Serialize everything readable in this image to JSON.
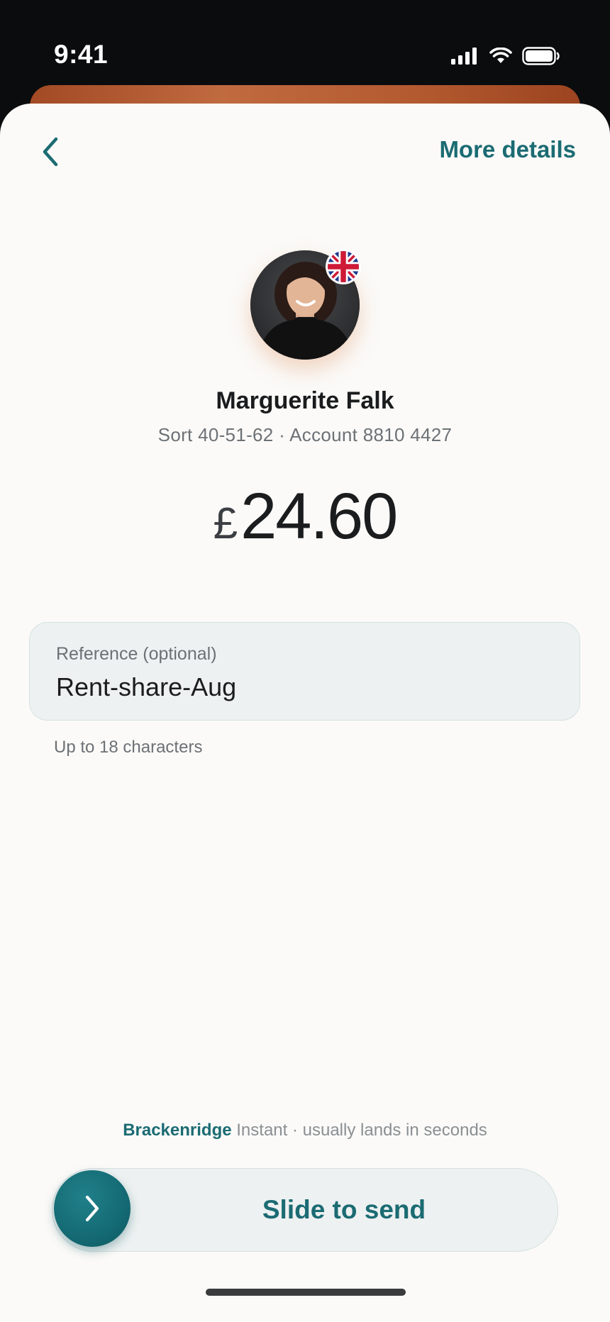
{
  "status_bar": {
    "time": "9:41",
    "icons": [
      "cellular-signal-icon",
      "wifi-icon",
      "battery-icon"
    ]
  },
  "header": {
    "back_icon": "chevron-left-icon",
    "more_details_label": "More details"
  },
  "payee": {
    "name": "Marguerite Falk",
    "account_line": "Sort 40-51-62 · Account 8810 4427",
    "country_flag": "uk-flag-icon"
  },
  "amount": {
    "currency_symbol": "£",
    "value": "24.60"
  },
  "reference": {
    "label": "Reference (optional)",
    "value": "Rent-share-Aug",
    "helper": "Up to 18 characters"
  },
  "transfer": {
    "brand": "Brackenridge",
    "speed_note": "Instant · usually lands in seconds"
  },
  "slider": {
    "label": "Slide to send",
    "handle_icon": "chevron-right-icon"
  },
  "colors": {
    "accent": "#1b6b73",
    "background": "#fbfaf8",
    "field_background": "#edf1f1",
    "behind_card": "#b45a30"
  }
}
